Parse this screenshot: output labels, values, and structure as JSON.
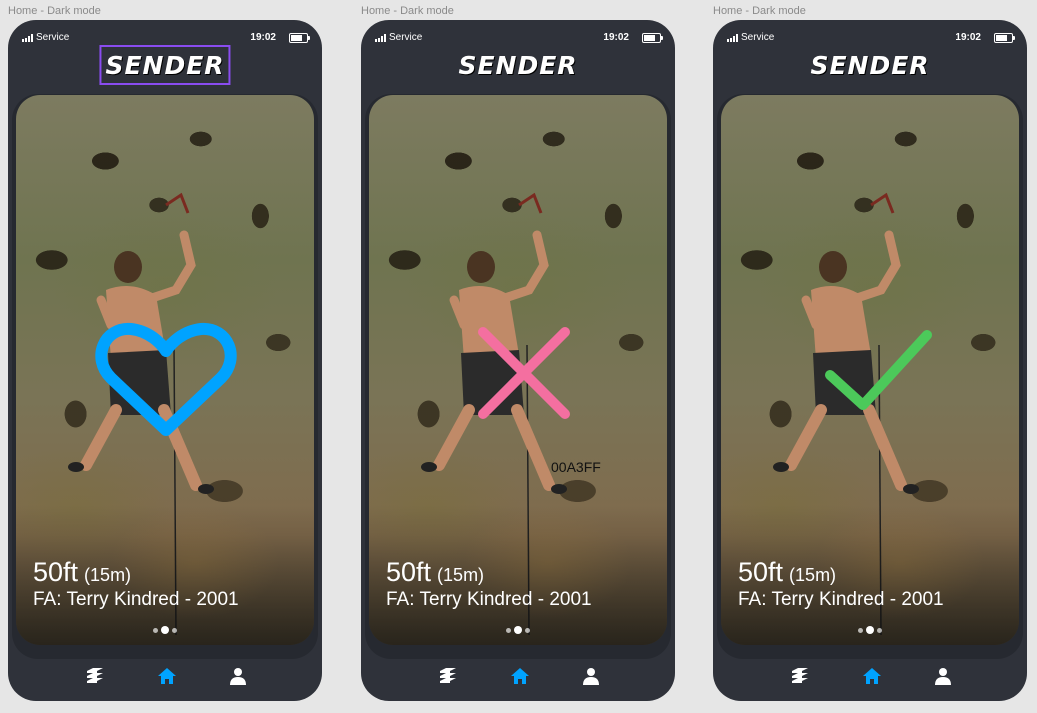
{
  "frames": [
    {
      "label": "Home - Dark mode",
      "overlay": "heart",
      "overlay_color": "#00A3FF"
    },
    {
      "label": "Home - Dark mode",
      "overlay": "cross",
      "overlay_color": "#F46FA0",
      "tag": "00A3FF"
    },
    {
      "label": "Home - Dark mode",
      "overlay": "check",
      "overlay_color": "#4CC95A"
    }
  ],
  "status": {
    "carrier": "Service",
    "time": "19:02"
  },
  "app": {
    "logo": "SENDER"
  },
  "route": {
    "height": "50ft",
    "meters": "(15m)",
    "first_ascent": "FA: Terry Kindred - 2001"
  },
  "tabs": [
    {
      "icon": "layers-icon",
      "active": false
    },
    {
      "icon": "home-icon",
      "active": true
    },
    {
      "icon": "user-icon",
      "active": false
    }
  ],
  "colors": {
    "background": "#e6e6e6",
    "phone": "#2f323a",
    "accent": "#00A3FF",
    "selection": "#8a4cf0"
  }
}
